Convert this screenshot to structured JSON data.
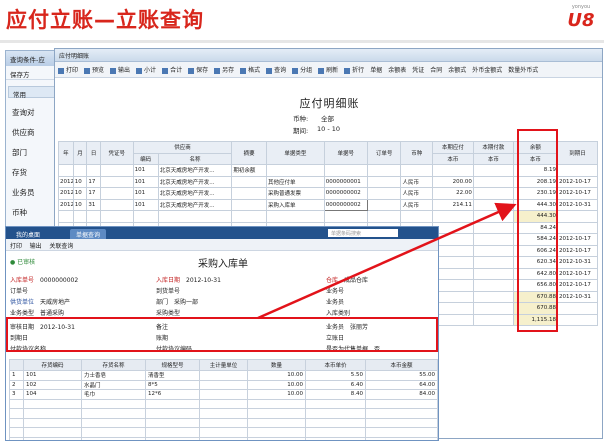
{
  "slide": {
    "title": "应付立账—立账查询",
    "logo_small": "yonyou",
    "logo_big": "U8"
  },
  "back_window": {
    "title": "查询条件-应",
    "save_label": "保存方",
    "section": "常用",
    "items": [
      "查询对",
      "供应商",
      "部门",
      "存货",
      "业务员",
      "币种"
    ]
  },
  "report_window": {
    "tab": "应付明细账",
    "toolbar": [
      "打印",
      "预览",
      "输出",
      "小计",
      "合计",
      "保存",
      "另存",
      "格式",
      "查询",
      "分组",
      "刷新",
      "折行",
      "单据",
      "余额表",
      "凭证",
      "合同",
      "余额式",
      "外币金额式",
      "数量外币式"
    ],
    "title": "应付明细账",
    "currency_label": "币种:",
    "currency_value": "全部",
    "period_label": "期间:",
    "period_value": "10  -  10",
    "table": {
      "group_header": "供应商",
      "headers": [
        "年",
        "月",
        "日",
        "凭证号",
        "编码",
        "名称",
        "摘要",
        "单据类型",
        "单据号",
        "订单号",
        "币种",
        "本期应付",
        "本期付款",
        "余额",
        "到期日"
      ],
      "sub_headers": [
        "本币",
        "本币",
        "本币"
      ],
      "rows": [
        [
          "",
          "",
          "",
          "",
          "101",
          "北京天威房地产开发...",
          "期初余额",
          "",
          "",
          "",
          "",
          "",
          "",
          "8.19",
          ""
        ],
        [
          "2012",
          "10",
          "17",
          "",
          "101",
          "北京天威房地产开发...",
          "",
          "其他应付单",
          "0000000001",
          "",
          "人民币",
          "200.00",
          "",
          "208.19",
          "2012-10-17"
        ],
        [
          "2012",
          "10",
          "17",
          "",
          "101",
          "北京天威房地产开发...",
          "",
          "采购普通发票",
          "0000000002",
          "",
          "人民币",
          "22.00",
          "",
          "230.19",
          "2012-10-17"
        ],
        [
          "2012",
          "10",
          "31",
          "",
          "101",
          "北京天威房地产开发...",
          "",
          "采购入库单",
          "0000000002",
          "",
          "人民币",
          "214.11",
          "",
          "444.30",
          "2012-10-31"
        ],
        [
          "",
          "",
          "",
          "",
          "",
          "",
          "",
          "",
          "",
          "",
          "",
          "",
          "",
          "444.30",
          ""
        ],
        [
          "",
          "",
          "",
          "",
          "",
          "",
          "",
          "",
          "",
          "",
          "",
          "",
          "",
          "84.24",
          ""
        ],
        [
          "",
          "",
          "",
          "",
          "",
          "",
          "",
          "",
          "",
          "",
          "",
          "",
          "",
          "584.24",
          "2012-10-17"
        ],
        [
          "",
          "",
          "",
          "",
          "",
          "",
          "",
          "",
          "",
          "",
          "",
          "",
          "",
          "606.24",
          "2012-10-17"
        ],
        [
          "",
          "",
          "",
          "",
          "",
          "",
          "",
          "",
          "",
          "",
          "",
          "",
          "",
          "620.34",
          "2012-10-31"
        ],
        [
          "",
          "",
          "",
          "",
          "",
          "",
          "",
          "",
          "",
          "",
          "",
          "",
          "",
          "642.80",
          "2012-10-17"
        ],
        [
          "",
          "",
          "",
          "",
          "",
          "",
          "",
          "",
          "",
          "",
          "",
          "",
          "",
          "656.80",
          "2012-10-17"
        ],
        [
          "",
          "",
          "",
          "",
          "",
          "",
          "",
          "",
          "",
          "",
          "",
          "",
          "",
          "670.88",
          "2012-10-31"
        ],
        [
          "",
          "",
          "",
          "",
          "",
          "",
          "",
          "",
          "",
          "",
          "",
          "",
          "",
          "670.88",
          ""
        ],
        [
          "",
          "",
          "",
          "",
          "",
          "",
          "",
          "",
          "",
          "",
          "",
          "",
          "",
          "1,115.18",
          ""
        ]
      ]
    }
  },
  "receipt_window": {
    "tabs": [
      "我的桌面",
      "单据查询"
    ],
    "search_placeholder": "单据条码搜索",
    "toolbar": [
      "打印",
      "输出",
      "关联查询"
    ],
    "approved": "已审核",
    "title": "采购入库单",
    "fields": {
      "doc_no_label": "入库单号",
      "doc_no": "0000000002",
      "in_date_label": "入库日期",
      "in_date": "2012-10-31",
      "warehouse_label": "仓库",
      "warehouse": "成品仓库",
      "order_no_label": "订单号",
      "arrival_no_label": "到货单号",
      "biz_no_label": "业务号",
      "vendor_label": "供货单位",
      "vendor": "天威房地产",
      "dept_label": "部门",
      "dept": "采购一部",
      "buyer_label": "业务员",
      "buyer": "",
      "biz_type_label": "业务类型",
      "biz_type": "普通采购",
      "pur_type_label": "采购类型",
      "inbound_type_label": "入库类别",
      "audit_date_label": "审核日期",
      "audit_date": "2012-10-31",
      "remark_label": "备注",
      "salesman_label": "业务员",
      "salesman": "张丽芳",
      "due_date_label": "到期日",
      "terms_label": "账期",
      "start_date_label": "立账日",
      "pay_terms_label": "付款协议名称",
      "pay_code_label": "付款协议编码",
      "agency_label": "是否为代售单据",
      "agency": "否"
    },
    "table": {
      "headers": [
        "",
        "存货编码",
        "存货名称",
        "规格型号",
        "主计量单位",
        "数量",
        "本币单价",
        "本币金额"
      ],
      "rows": [
        [
          "1",
          "101",
          "力士香皂",
          "清香型",
          "",
          "10.00",
          "5.50",
          "55.00"
        ],
        [
          "2",
          "102",
          "水晶门",
          "8*5",
          "",
          "10.00",
          "6.40",
          "64.00"
        ],
        [
          "3",
          "104",
          "毛巾",
          "12*6",
          "",
          "10.00",
          "8.40",
          "84.00"
        ]
      ]
    }
  },
  "colors": {
    "title_red": "#d8261c",
    "highlight_red": "#e2131a",
    "nav_blue": "#23528c"
  }
}
